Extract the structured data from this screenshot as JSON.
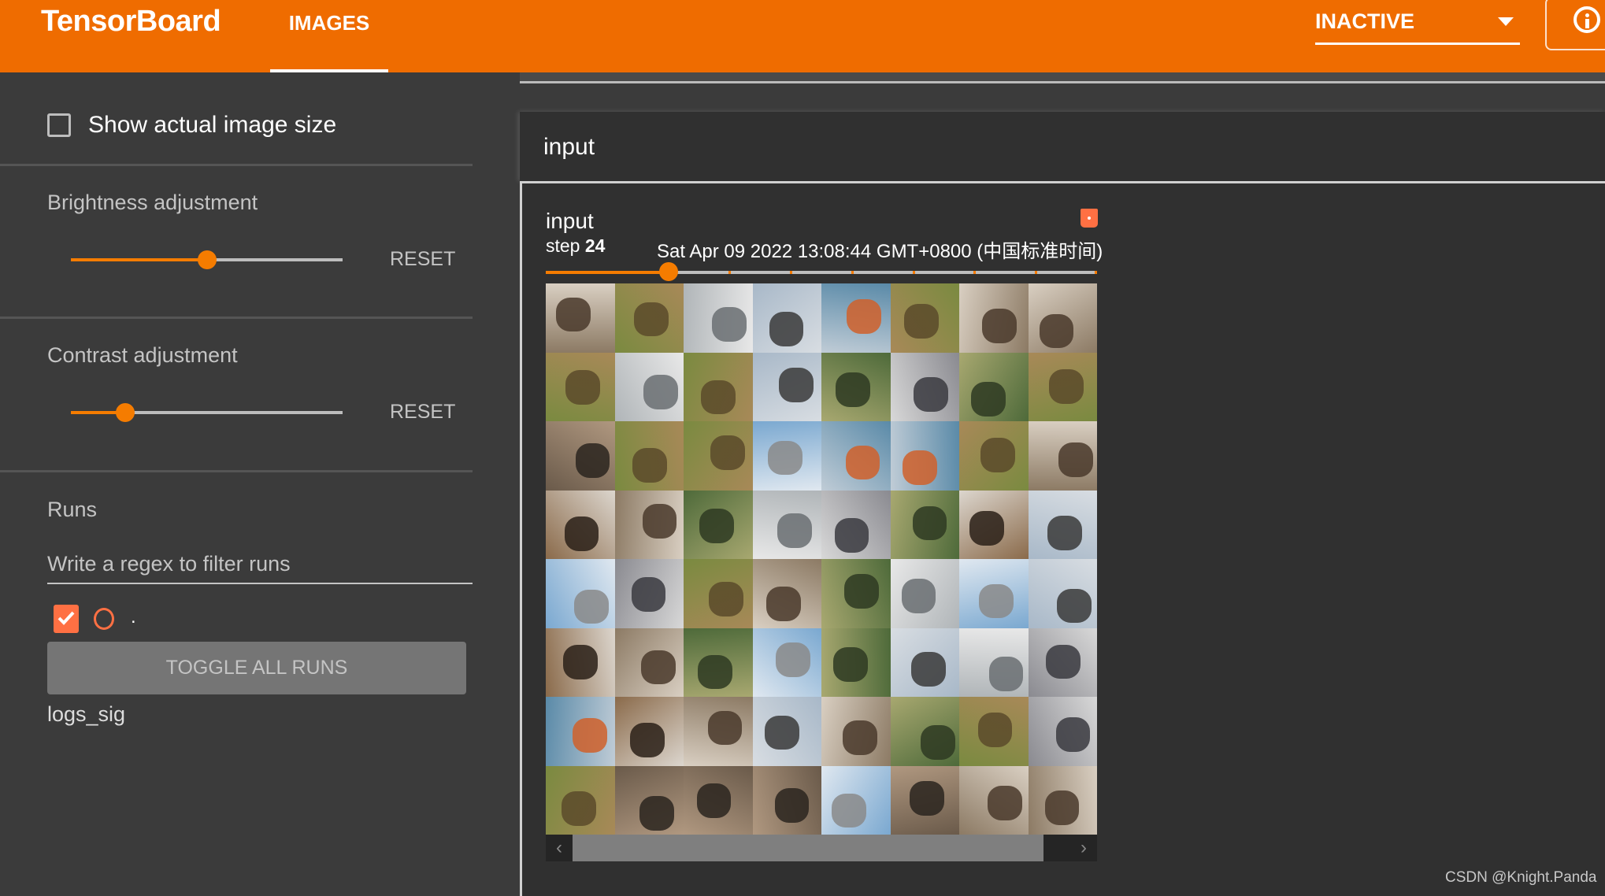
{
  "header": {
    "brand": "TensorBoard",
    "active_tab": "IMAGES",
    "plugin_selector": "INACTIVE",
    "info_icon": "info-circle-icon"
  },
  "sidebar": {
    "show_actual_size": {
      "label": "Show actual image size",
      "checked": false
    },
    "brightness": {
      "title": "Brightness adjustment",
      "value_fraction": 0.5,
      "reset_label": "RESET"
    },
    "contrast": {
      "title": "Contrast adjustment",
      "value_fraction": 0.2,
      "reset_label": "RESET"
    },
    "runs": {
      "title": "Runs",
      "filter_placeholder": "Write a regex to filter runs",
      "filter_value": "",
      "items": [
        {
          "name": ".",
          "checked": true,
          "color": "#ff7043"
        }
      ],
      "toggle_all_label": "TOGGLE ALL RUNS",
      "log_dir": "logs_sig"
    }
  },
  "main": {
    "pane_title": "input",
    "card": {
      "tag": "input",
      "step_prefix": "step",
      "step": "24",
      "timestamp": "Sat Apr 09 2022 13:08:44 GMT+0800 (中国标准时间)",
      "run_color": "#ff7043",
      "step_slider": {
        "positions": 10,
        "current_index": 2
      },
      "grid": {
        "rows": 8,
        "cols": 8,
        "tiles": [
          [
            "dog",
            "deer",
            "truck",
            "bird",
            "ship",
            "deer",
            "dog",
            "dog"
          ],
          [
            "deer",
            "truck",
            "deer",
            "bird",
            "frog",
            "car",
            "frog",
            "deer"
          ],
          [
            "cat",
            "deer",
            "deer",
            "airplane",
            "ship",
            "ship",
            "deer",
            "dog"
          ],
          [
            "horse",
            "dog",
            "frog",
            "truck",
            "car",
            "frog",
            "horse",
            "bird"
          ],
          [
            "airplane",
            "car",
            "deer",
            "dog",
            "frog",
            "truck",
            "airplane",
            "bird"
          ],
          [
            "horse",
            "dog",
            "frog",
            "airplane",
            "frog",
            "bird",
            "truck",
            "car"
          ],
          [
            "ship",
            "horse",
            "dog",
            "bird",
            "dog",
            "frog",
            "deer",
            "car"
          ],
          [
            "deer",
            "cat",
            "cat",
            "cat",
            "airplane",
            "cat",
            "dog",
            "dog"
          ]
        ]
      },
      "scroll": {
        "left_icon": "chevron-left-icon",
        "right_icon": "chevron-right-icon"
      }
    }
  },
  "watermark": "CSDN @Knight.Panda"
}
